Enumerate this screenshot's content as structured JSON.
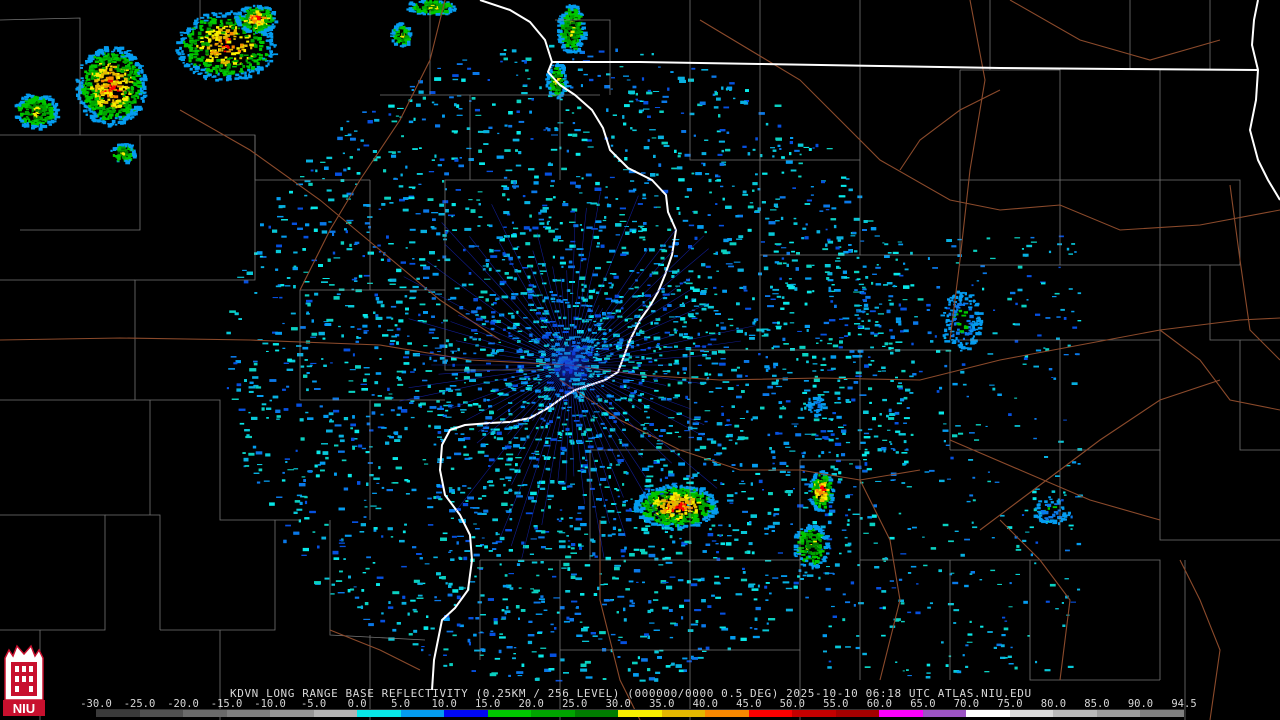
{
  "product": {
    "title_line": "KDVN LONG RANGE BASE REFLECTIVITY (0.25KM / 256 LEVEL) (000000/0000 0.5 DEG) 2025-10-10 06:18 UTC  ATLAS.NIU.EDU"
  },
  "scale": {
    "labels": [
      "-30.0",
      "-25.0",
      "-20.0",
      "-15.0",
      "-10.0",
      "-5.0",
      "0.0",
      "5.0",
      "10.0",
      "15.0",
      "20.0",
      "25.0",
      "30.0",
      "35.0",
      "40.0",
      "45.0",
      "50.0",
      "55.0",
      "60.0",
      "65.0",
      "70.0",
      "75.0",
      "80.0",
      "85.0",
      "90.0",
      "94.5"
    ],
    "colors": [
      "#3a3a3a",
      "#505050",
      "#6a6a6a",
      "#7e7e7e",
      "#969696",
      "#b4b4b4",
      "#08e8e8",
      "#049cf0",
      "#0008f4",
      "#00c800",
      "#00a400",
      "#007c00",
      "#f8f000",
      "#e4b800",
      "#f88800",
      "#fc0000",
      "#c40000",
      "#a40000",
      "#fc00fc",
      "#9c54c4",
      "#ffffff",
      "#d8d8d8",
      "#b8b8b8",
      "#9c9c9c",
      "#808080"
    ]
  },
  "logo": {
    "text": "NIU",
    "colors": {
      "red": "#c8102e",
      "white": "#ffffff"
    }
  },
  "map": {
    "colors": {
      "state_border": "#ffffff",
      "county_line": "#8a8a8a",
      "highway": "#8b4a2b",
      "background": "#000000"
    }
  }
}
